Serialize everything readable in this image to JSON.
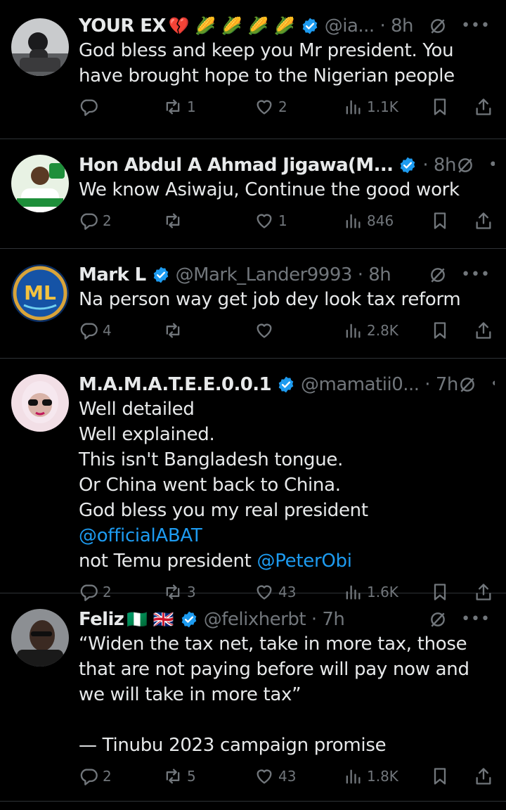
{
  "colors": {
    "background": "#000000",
    "text": "#e7e9ea",
    "secondary": "#71767b",
    "link": "#1d9bf0",
    "verified": "#1d9bf0",
    "divider": "#2f3336"
  },
  "tweets": [
    {
      "name": "YOUR EX",
      "emoji": "💔 🌽 🌽 🌽 🌽",
      "verified": true,
      "handle_time": "@ia... · 8h",
      "text": "God bless and keep you Mr president. You have brought hope to the Nigerian people",
      "replies": "",
      "reposts": "1",
      "likes": "2",
      "views": "1.1K"
    },
    {
      "name": "Hon Abdul A Ahmad Jigawa(M...",
      "emoji": "",
      "verified": true,
      "handle_time": "· 8h",
      "text": "We know Asiwaju, Continue the good work",
      "replies": "2",
      "reposts": "",
      "likes": "1",
      "views": "846"
    },
    {
      "name": "Mark L",
      "emoji": "",
      "verified": true,
      "handle_time": "@Mark_Lander9993 · 8h",
      "text": "Na person way get job dey look tax reform",
      "replies": "4",
      "reposts": "",
      "likes": "",
      "views": "2.8K"
    },
    {
      "name": "M.A.M.A.T.E.E.0.0.1",
      "emoji": "",
      "verified": true,
      "handle_time": "@mamatii0... · 7h",
      "text_lines": [
        "Well detailed",
        "Well explained.",
        "This isn't Bangladesh tongue.",
        "Or China went back to China.",
        "God bless you my real president "
      ],
      "mention1": "@officialABAT",
      "text_after": "not Temu president ",
      "mention2": "@PeterObi",
      "replies": "2",
      "reposts": "3",
      "likes": "43",
      "views": "1.6K"
    },
    {
      "name": "Feliz",
      "emoji": "🇳🇬 🇬🇧",
      "verified": true,
      "handle_time": "@felixherbt · 7h",
      "text": "“Widen the tax net, take in more tax, those that are not paying before will pay now and we will take in more tax”\n\n— Tinubu 2023 campaign promise",
      "replies": "2",
      "reposts": "5",
      "likes": "43",
      "views": "1.8K"
    }
  ]
}
